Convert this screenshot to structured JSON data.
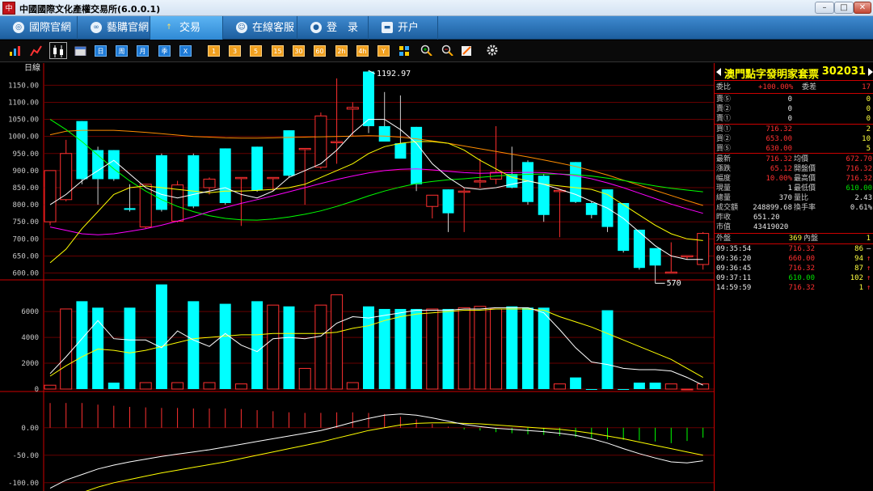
{
  "window": {
    "title": "中國國際文化產權交易所(6.0.0.1)",
    "icon_label": "中",
    "controls": {
      "minimize": "–",
      "maximize": "□",
      "close": "✕"
    }
  },
  "nav": {
    "items": [
      {
        "label": "國際官網",
        "icon": "globe-icon"
      },
      {
        "label": "藝購官網",
        "icon": "link-icon"
      },
      {
        "label": "交易",
        "icon": "trade-icon",
        "active": true
      },
      {
        "label": "在線客服",
        "icon": "chat-icon"
      },
      {
        "label": "登　录",
        "icon": "user-icon"
      },
      {
        "label": "开户",
        "icon": "card-icon"
      }
    ]
  },
  "toolbar": {
    "period_buttons": [
      "日",
      "周",
      "月",
      "季",
      "X"
    ],
    "minute_buttons": [
      "1",
      "3",
      "5",
      "15",
      "30",
      "60",
      "2h",
      "4h",
      "Y"
    ]
  },
  "chart": {
    "period_label": "日線",
    "price_ticks": [
      "1150.00",
      "1100.00",
      "1050.00",
      "1000.00",
      "950.00",
      "900.00",
      "850.00",
      "800.00",
      "750.00",
      "700.00",
      "650.00",
      "600.00"
    ],
    "volume_ticks": [
      "6000",
      "4000",
      "2000",
      "0"
    ],
    "macd_ticks": [
      "0.00",
      "-50.00",
      "-100.00"
    ],
    "high_label": "1192.97",
    "low_label": "570",
    "colors": {
      "up": "#ff3030",
      "down": "#00ffff",
      "ma5": "#ffffff",
      "ma10": "#ffff00",
      "ma20": "#ff00ff",
      "ma30": "#00ff00",
      "ma60": "#ff8c00"
    }
  },
  "chart_data": {
    "type": "candlestick",
    "ylim": [
      580,
      1210
    ],
    "candles": [
      {
        "o": 750,
        "h": 900,
        "l": 740,
        "c": 900
      },
      {
        "o": 815,
        "h": 990,
        "l": 810,
        "c": 950
      },
      {
        "o": 1045,
        "h": 1045,
        "l": 860,
        "c": 875
      },
      {
        "o": 960,
        "h": 970,
        "l": 800,
        "c": 875
      },
      {
        "o": 960,
        "h": 960,
        "l": 870,
        "c": 875
      },
      {
        "o": 790,
        "h": 860,
        "l": 780,
        "c": 785
      },
      {
        "o": 735,
        "h": 860,
        "l": 730,
        "c": 860
      },
      {
        "o": 945,
        "h": 950,
        "l": 780,
        "c": 785
      },
      {
        "o": 752,
        "h": 870,
        "l": 748,
        "c": 858
      },
      {
        "o": 945,
        "h": 950,
        "l": 790,
        "c": 795
      },
      {
        "o": 850,
        "h": 880,
        "l": 830,
        "c": 875
      },
      {
        "o": 965,
        "h": 965,
        "l": 800,
        "c": 805
      },
      {
        "o": 880,
        "h": 880,
        "l": 738,
        "c": 880
      },
      {
        "o": 970,
        "h": 970,
        "l": 838,
        "c": 842
      },
      {
        "o": 880,
        "h": 880,
        "l": 840,
        "c": 880
      },
      {
        "o": 1018,
        "h": 1018,
        "l": 880,
        "c": 885
      },
      {
        "o": 965,
        "h": 965,
        "l": 800,
        "c": 965
      },
      {
        "o": 910,
        "h": 1070,
        "l": 905,
        "c": 1060
      },
      {
        "o": 985,
        "h": 1170,
        "l": 920,
        "c": 985
      },
      {
        "o": 1080,
        "h": 1100,
        "l": 1000,
        "c": 1085
      },
      {
        "o": 1190,
        "h": 1193,
        "l": 1010,
        "c": 1030
      },
      {
        "o": 1030,
        "h": 1130,
        "l": 990,
        "c": 985
      },
      {
        "o": 980,
        "h": 1120,
        "l": 940,
        "c": 935
      },
      {
        "o": 1028,
        "h": 1028,
        "l": 840,
        "c": 860
      },
      {
        "o": 795,
        "h": 820,
        "l": 760,
        "c": 828
      },
      {
        "o": 845,
        "h": 845,
        "l": 720,
        "c": 775
      },
      {
        "o": 840,
        "h": 850,
        "l": 720,
        "c": 840
      },
      {
        "o": 870,
        "h": 935,
        "l": 850,
        "c": 870
      },
      {
        "o": 875,
        "h": 1030,
        "l": 860,
        "c": 895
      },
      {
        "o": 890,
        "h": 970,
        "l": 848,
        "c": 850
      },
      {
        "o": 925,
        "h": 930,
        "l": 800,
        "c": 808
      },
      {
        "o": 885,
        "h": 890,
        "l": 750,
        "c": 770
      },
      {
        "o": 840,
        "h": 845,
        "l": 705,
        "c": 842
      },
      {
        "o": 925,
        "h": 925,
        "l": 805,
        "c": 808
      },
      {
        "o": 805,
        "h": 810,
        "l": 760,
        "c": 770
      },
      {
        "o": 845,
        "h": 845,
        "l": 720,
        "c": 735
      },
      {
        "o": 805,
        "h": 805,
        "l": 660,
        "c": 665
      },
      {
        "o": 727,
        "h": 727,
        "l": 610,
        "c": 615
      },
      {
        "o": 673,
        "h": 673,
        "l": 570,
        "c": 622
      },
      {
        "o": 600,
        "h": 690,
        "l": 600,
        "c": 603
      },
      {
        "o": 651,
        "h": 652,
        "l": 640,
        "c": 651
      },
      {
        "o": 625,
        "h": 720,
        "l": 610,
        "c": 716
      }
    ],
    "ma5": [
      800,
      830,
      870,
      900,
      930,
      890,
      850,
      830,
      820,
      830,
      840,
      850,
      830,
      820,
      840,
      880,
      900,
      920,
      960,
      1010,
      1050,
      1050,
      1020,
      980,
      920,
      880,
      850,
      845,
      850,
      860,
      870,
      860,
      845,
      830,
      810,
      790,
      760,
      720,
      680,
      650,
      640,
      640
    ],
    "ma10": [
      630,
      670,
      730,
      780,
      830,
      850,
      855,
      850,
      845,
      840,
      835,
      840,
      840,
      842,
      845,
      850,
      860,
      880,
      900,
      920,
      950,
      970,
      980,
      985,
      985,
      980,
      960,
      930,
      905,
      880,
      870,
      860,
      855,
      850,
      845,
      830,
      800,
      770,
      740,
      715,
      700,
      695
    ],
    "ma20": [
      735,
      725,
      715,
      712,
      715,
      722,
      730,
      740,
      752,
      765,
      780,
      792,
      804,
      815,
      826,
      838,
      850,
      862,
      874,
      884,
      893,
      900,
      904,
      905,
      902,
      898,
      894,
      892,
      893,
      894,
      895,
      894,
      890,
      885,
      876,
      864,
      850,
      834,
      818,
      802,
      788,
      775
    ],
    "ma30": [
      1050,
      1020,
      985,
      945,
      905,
      870,
      840,
      815,
      795,
      780,
      768,
      760,
      756,
      755,
      758,
      764,
      772,
      782,
      795,
      810,
      826,
      840,
      852,
      862,
      868,
      873,
      876,
      880,
      884,
      887,
      889,
      890,
      890,
      888,
      884,
      878,
      871,
      863,
      855,
      848,
      843,
      838
    ],
    "ma60": [
      1005,
      1015,
      1018,
      1018,
      1018,
      1015,
      1012,
      1008,
      1004,
      1000,
      998,
      996,
      995,
      995,
      996,
      997,
      998,
      999,
      1000,
      1001,
      1002,
      1001,
      998,
      993,
      987,
      980,
      972,
      964,
      956,
      948,
      940,
      931,
      922,
      912,
      900,
      887,
      872,
      857,
      842,
      827,
      812,
      798
    ],
    "volume": {
      "ylim": [
        0,
        8200
      ],
      "values": [
        300,
        6200,
        6800,
        6300,
        500,
        6300,
        500,
        8100,
        500,
        6800,
        500,
        6600,
        400,
        6800,
        6500,
        6400,
        1600,
        6500,
        7300,
        500,
        6400,
        6200,
        6200,
        6200,
        6200,
        6200,
        6300,
        6400,
        6200,
        6400,
        6300,
        6300,
        400,
        900,
        0,
        6100,
        0,
        500,
        500,
        400,
        0,
        400
      ],
      "ma5": [
        1200,
        2500,
        3900,
        5300,
        3900,
        3800,
        3800,
        3200,
        4500,
        3800,
        3300,
        4300,
        3400,
        2900,
        3900,
        4000,
        3900,
        4100,
        5100,
        5600,
        5500,
        5700,
        5900,
        6100,
        6100,
        6100,
        6200,
        6200,
        6300,
        6300,
        6300,
        5900,
        4600,
        3200,
        2100,
        1900,
        1600,
        1500,
        1500,
        1400,
        900,
        300
      ],
      "ma10": [
        1000,
        1800,
        2500,
        3100,
        3000,
        2800,
        3000,
        3300,
        3600,
        3900,
        4000,
        4100,
        4200,
        4200,
        4300,
        4300,
        4300,
        4300,
        4400,
        4700,
        4900,
        5300,
        5600,
        5800,
        5900,
        6000,
        6100,
        6100,
        6200,
        6200,
        6200,
        6100,
        5600,
        5200,
        4800,
        4300,
        3800,
        3300,
        2800,
        2300,
        1600,
        900
      ]
    },
    "macd": {
      "ylim": [
        -115,
        60
      ],
      "dif": [
        -110,
        -95,
        -85,
        -75,
        -68,
        -62,
        -57,
        -52,
        -48,
        -44,
        -40,
        -35,
        -30,
        -25,
        -20,
        -15,
        -10,
        -5,
        2,
        10,
        17,
        23,
        25,
        23,
        18,
        12,
        6,
        2,
        -1,
        -3,
        -5,
        -7,
        -10,
        -14,
        -20,
        -28,
        -38,
        -47,
        -55,
        -62,
        -64,
        -60
      ],
      "dea": [
        -140,
        -128,
        -118,
        -108,
        -100,
        -94,
        -88,
        -82,
        -77,
        -72,
        -67,
        -62,
        -56,
        -50,
        -44,
        -38,
        -32,
        -26,
        -19,
        -12,
        -5,
        0,
        5,
        8,
        9,
        9,
        8,
        7,
        5,
        3,
        1,
        -1,
        -3,
        -6,
        -10,
        -15,
        -20,
        -26,
        -32,
        -38,
        -44,
        -50
      ],
      "hist": [
        45,
        45,
        45,
        42,
        40,
        38,
        37,
        36,
        36,
        35,
        35,
        35,
        34,
        32,
        30,
        28,
        27,
        27,
        28,
        28,
        27,
        25,
        20,
        15,
        7,
        2,
        -3,
        -5,
        -8,
        -10,
        -12,
        -13,
        -15,
        -17,
        -19,
        -21,
        -22,
        -23,
        -25,
        -28,
        -24,
        -18
      ]
    }
  },
  "panel": {
    "stock_name": "澳門點字發明家套票",
    "stock_code": "302031",
    "ratio_row": {
      "label": "委比",
      "value": "+100.00%",
      "label2": "委差",
      "value2": "17"
    },
    "sells": [
      {
        "label": "賣⑤",
        "price": "0",
        "vol": "0"
      },
      {
        "label": "賣②",
        "price": "0",
        "vol": "0"
      },
      {
        "label": "賣①",
        "price": "0",
        "vol": "0"
      }
    ],
    "buys": [
      {
        "label": "買①",
        "price": "716.32",
        "vol": "2"
      },
      {
        "label": "買②",
        "price": "653.00",
        "vol": "10"
      },
      {
        "label": "買⑤",
        "price": "630.00",
        "vol": "5"
      }
    ],
    "stats": [
      {
        "l1": "最新",
        "v1": "716.32",
        "c1": "red",
        "l2": "均價",
        "v2": "672.70",
        "c2": "red"
      },
      {
        "l1": "漲跌",
        "v1": "65.12",
        "c1": "red",
        "l2": "開盤價",
        "v2": "716.32",
        "c2": "red"
      },
      {
        "l1": "幅度",
        "v1": "10.00%",
        "c1": "red",
        "l2": "最高價",
        "v2": "716.32",
        "c2": "red"
      },
      {
        "l1": "現量",
        "v1": "1",
        "c1": "white",
        "l2": "最低價",
        "v2": "610.00",
        "c2": "green"
      },
      {
        "l1": "總量",
        "v1": "370",
        "c1": "white",
        "l2": "量比",
        "v2": "2.43",
        "c2": "white"
      },
      {
        "l1": "成交額",
        "v1": "248899.68",
        "c1": "white",
        "l2": "換手率",
        "v2": "0.61%",
        "c2": "white"
      },
      {
        "l1": "昨收",
        "v1": "651.20",
        "c1": "white",
        "l2": "",
        "v2": "",
        "c2": "white"
      },
      {
        "l1": "市值",
        "v1": "43419020",
        "c1": "white",
        "l2": "",
        "v2": "",
        "c2": "white"
      }
    ],
    "outer_inner": {
      "l1": "外盤",
      "v1": "369",
      "l2": "內盤",
      "v2": "1"
    },
    "trades": [
      {
        "time": "09:35:54",
        "price": "716.32",
        "pc": "red",
        "vol": "86",
        "arrow": "–"
      },
      {
        "time": "09:36:20",
        "price": "660.00",
        "pc": "red",
        "vol": "94",
        "arrow": "↑"
      },
      {
        "time": "09:36:45",
        "price": "716.32",
        "pc": "red",
        "vol": "87",
        "arrow": "↑"
      },
      {
        "time": "09:37:11",
        "price": "610.00",
        "pc": "green",
        "vol": "102",
        "arrow": "↑"
      },
      {
        "time": "14:59:59",
        "price": "716.32",
        "pc": "red",
        "vol": "1",
        "arrow": "↑"
      }
    ]
  }
}
